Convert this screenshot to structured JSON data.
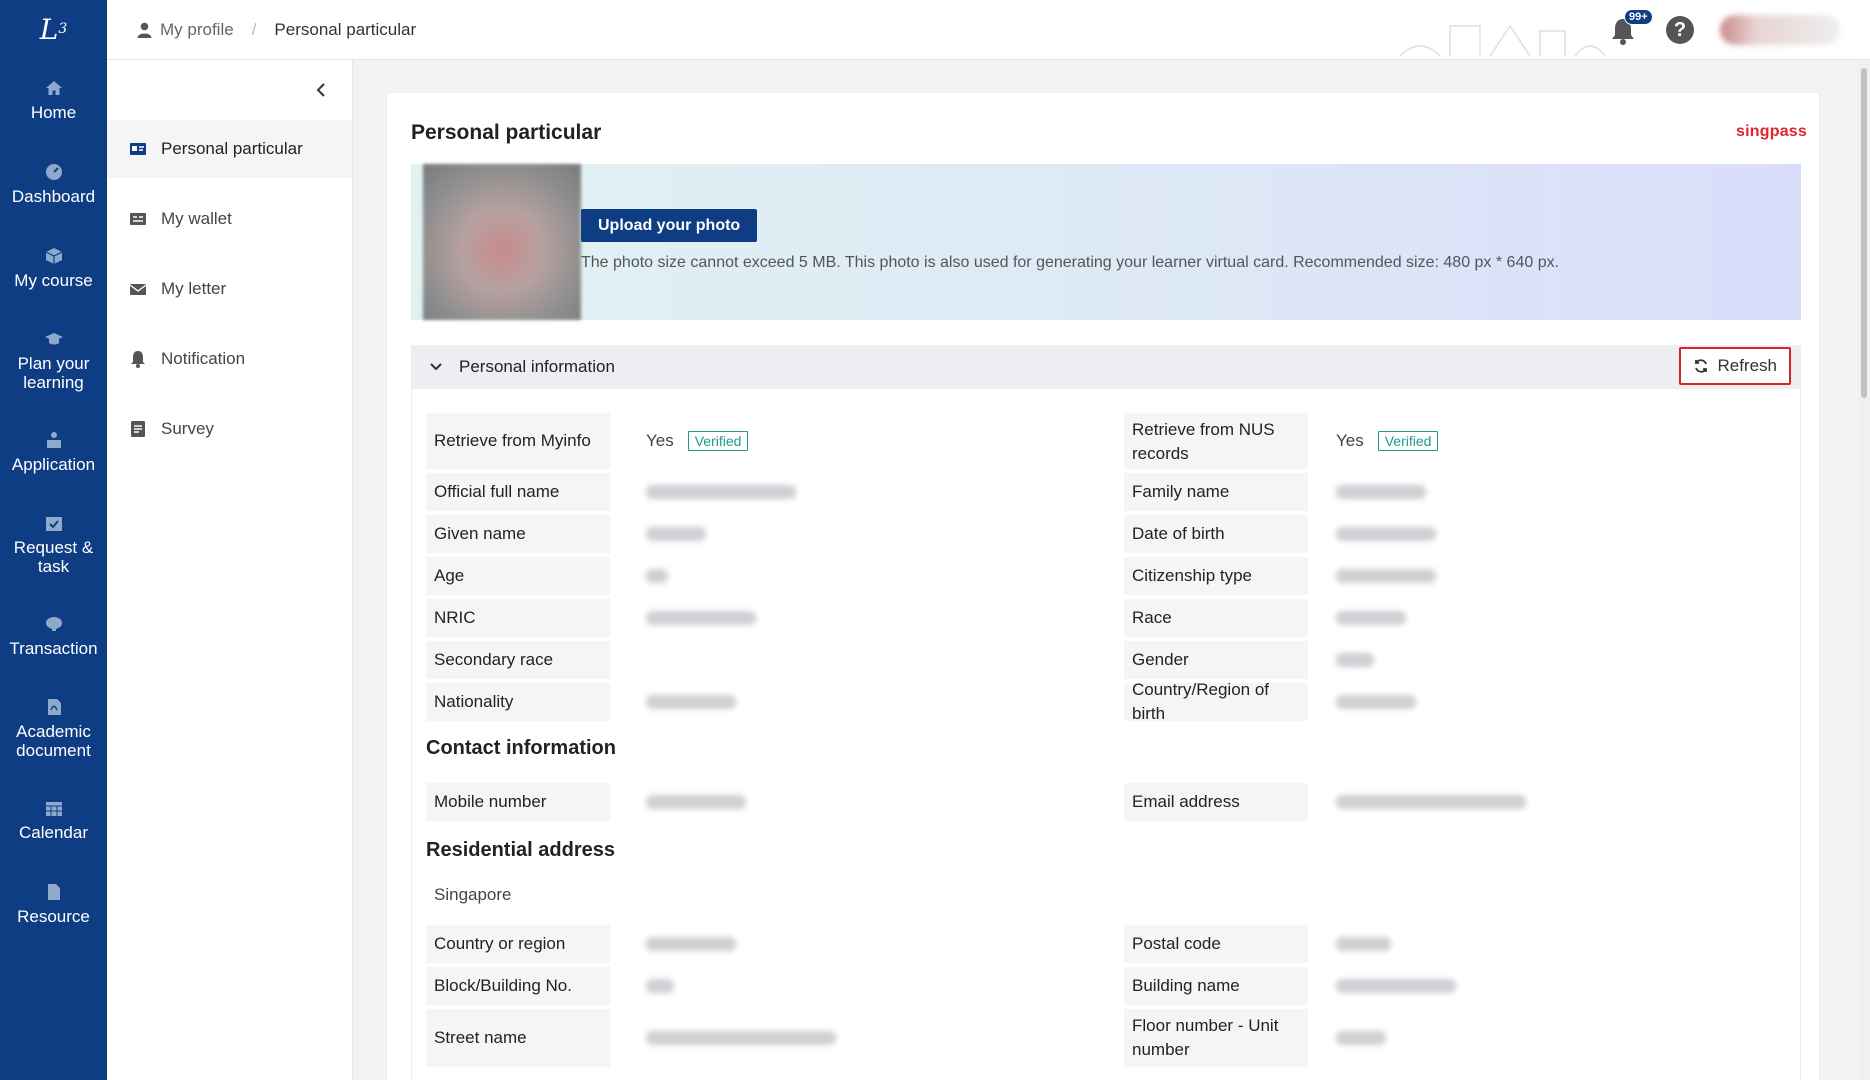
{
  "leftnav": {
    "items": [
      {
        "label": "Home",
        "icon": "home-icon"
      },
      {
        "label": "Dashboard",
        "icon": "dashboard-icon"
      },
      {
        "label": "My course",
        "icon": "cube-icon"
      },
      {
        "label": "Plan your learning",
        "icon": "graduation-cap-icon"
      },
      {
        "label": "Application",
        "icon": "application-icon"
      },
      {
        "label": "Request & task",
        "icon": "calendar-check-icon"
      },
      {
        "label": "Transaction",
        "icon": "transaction-icon"
      },
      {
        "label": "Academic document",
        "icon": "pdf-file-icon"
      },
      {
        "label": "Calendar",
        "icon": "calendar-icon"
      },
      {
        "label": "Resource",
        "icon": "file-icon"
      }
    ]
  },
  "header": {
    "breadcrumb_home": "My profile",
    "breadcrumb_sep": "/",
    "breadcrumb_current": "Personal particular",
    "notification_badge": "99+",
    "help_label": "?"
  },
  "subnav": {
    "items": [
      {
        "label": "Personal particular",
        "icon": "id-card-icon",
        "active": true
      },
      {
        "label": "My wallet",
        "icon": "wallet-icon",
        "active": false
      },
      {
        "label": "My letter",
        "icon": "envelope-icon",
        "active": false
      },
      {
        "label": "Notification",
        "icon": "bell-icon",
        "active": false
      },
      {
        "label": "Survey",
        "icon": "survey-icon",
        "active": false
      }
    ]
  },
  "card": {
    "title": "Personal particular",
    "brand": "singpass",
    "upload_label": "Upload your photo",
    "upload_note": "The photo size cannot exceed 5 MB. This photo is also used for generating your learner virtual card. Recommended size: 480 px * 640 px.",
    "section_title": "Personal information",
    "refresh_label": "Refresh"
  },
  "personal": {
    "myinfo_label": "Retrieve from Myinfo",
    "myinfo_value": "Yes",
    "nus_label": "Retrieve from NUS records",
    "nus_value": "Yes",
    "verified_label": "Verified",
    "fields_left": [
      "Official full name",
      "Given name",
      "Age",
      "NRIC",
      "Secondary race",
      "Nationality"
    ],
    "fields_right": [
      "Family name",
      "Date of birth",
      "Citizenship type",
      "Race",
      "Gender",
      "Country/Region of birth"
    ]
  },
  "contact": {
    "title": "Contact information",
    "mobile_label": "Mobile number",
    "email_label": "Email address"
  },
  "address": {
    "title": "Residential address",
    "country_text": "Singapore",
    "fields_left": [
      "Country or region",
      "Block/Building No.",
      "Street name"
    ],
    "fields_right": [
      "Postal code",
      "Building name",
      "Floor number - Unit number"
    ]
  },
  "colors": {
    "nav_bg": "#0f3d84",
    "accent": "#0f3d84",
    "verified": "#1f9a8f",
    "refresh_border": "#d62525",
    "singpass": "#e1242f"
  }
}
